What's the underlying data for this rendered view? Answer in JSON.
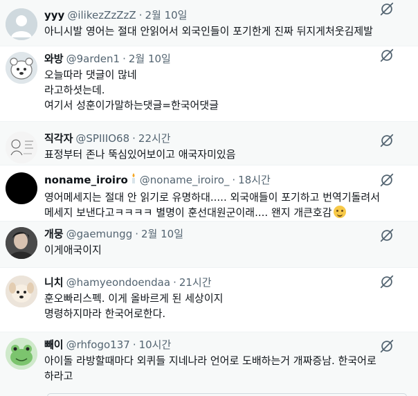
{
  "tweets": [
    {
      "name": "yyy",
      "handle": "@ilikezZzZzZ",
      "time": "2월 10일",
      "text": "아니시발 영어는 절대 안읽어서 외국인들이 포기한게 진짜 뒤지게처웃김제발"
    },
    {
      "name": "와방",
      "handle": "@9arden1",
      "time": "2월 10일",
      "text": "오늘따라 댓글이 많네\n라고하셧는데.\n여기서 성훈이가말하는댓글=한국어댓글"
    },
    {
      "name": "직각자",
      "handle": "@SPIIIO68",
      "time": "22시간",
      "text": "표정부터 존나 뚝심있어보이고 애국자미있음"
    },
    {
      "name": "noname_iroiro",
      "handle": "@noname_iroiro_",
      "time": "18시간",
      "text": "영어메세지는 절대 안 읽기로 유명하대..... 외국애들이 포기하고 번역기돌려서\n메세지 보낸다고ㅋㅋㅋㅋ 별명이 훈선대원군이래.... 왠지 개큰호감"
    },
    {
      "name": "개뭉",
      "handle": "@gaemungg",
      "time": "2월 10일",
      "text": "이게애국이지"
    },
    {
      "name": "니치",
      "handle": "@hamyeondoendaa",
      "time": "21시간",
      "text": "훈오빠리스펙. 이게 올바르게 된 세상이지\n명령하지마라 한국어로한다."
    },
    {
      "name": "빼이",
      "handle": "@rhfogo137",
      "time": "10시간",
      "text": "아이돌 라방할때마다 외퀴들 지네나라 언어로 도배하는거 개짜증남. 한국어로\n하라고"
    }
  ],
  "separator": "·",
  "colors": {
    "name": "#0f1419",
    "meta": "#536471",
    "bg_alt": "#f7f9f9",
    "divider": "#eff3f4"
  },
  "icons": {
    "mute": "mute-icon",
    "badge": "candle-badge-icon",
    "emoji": "pleading-face-emoji-icon"
  }
}
